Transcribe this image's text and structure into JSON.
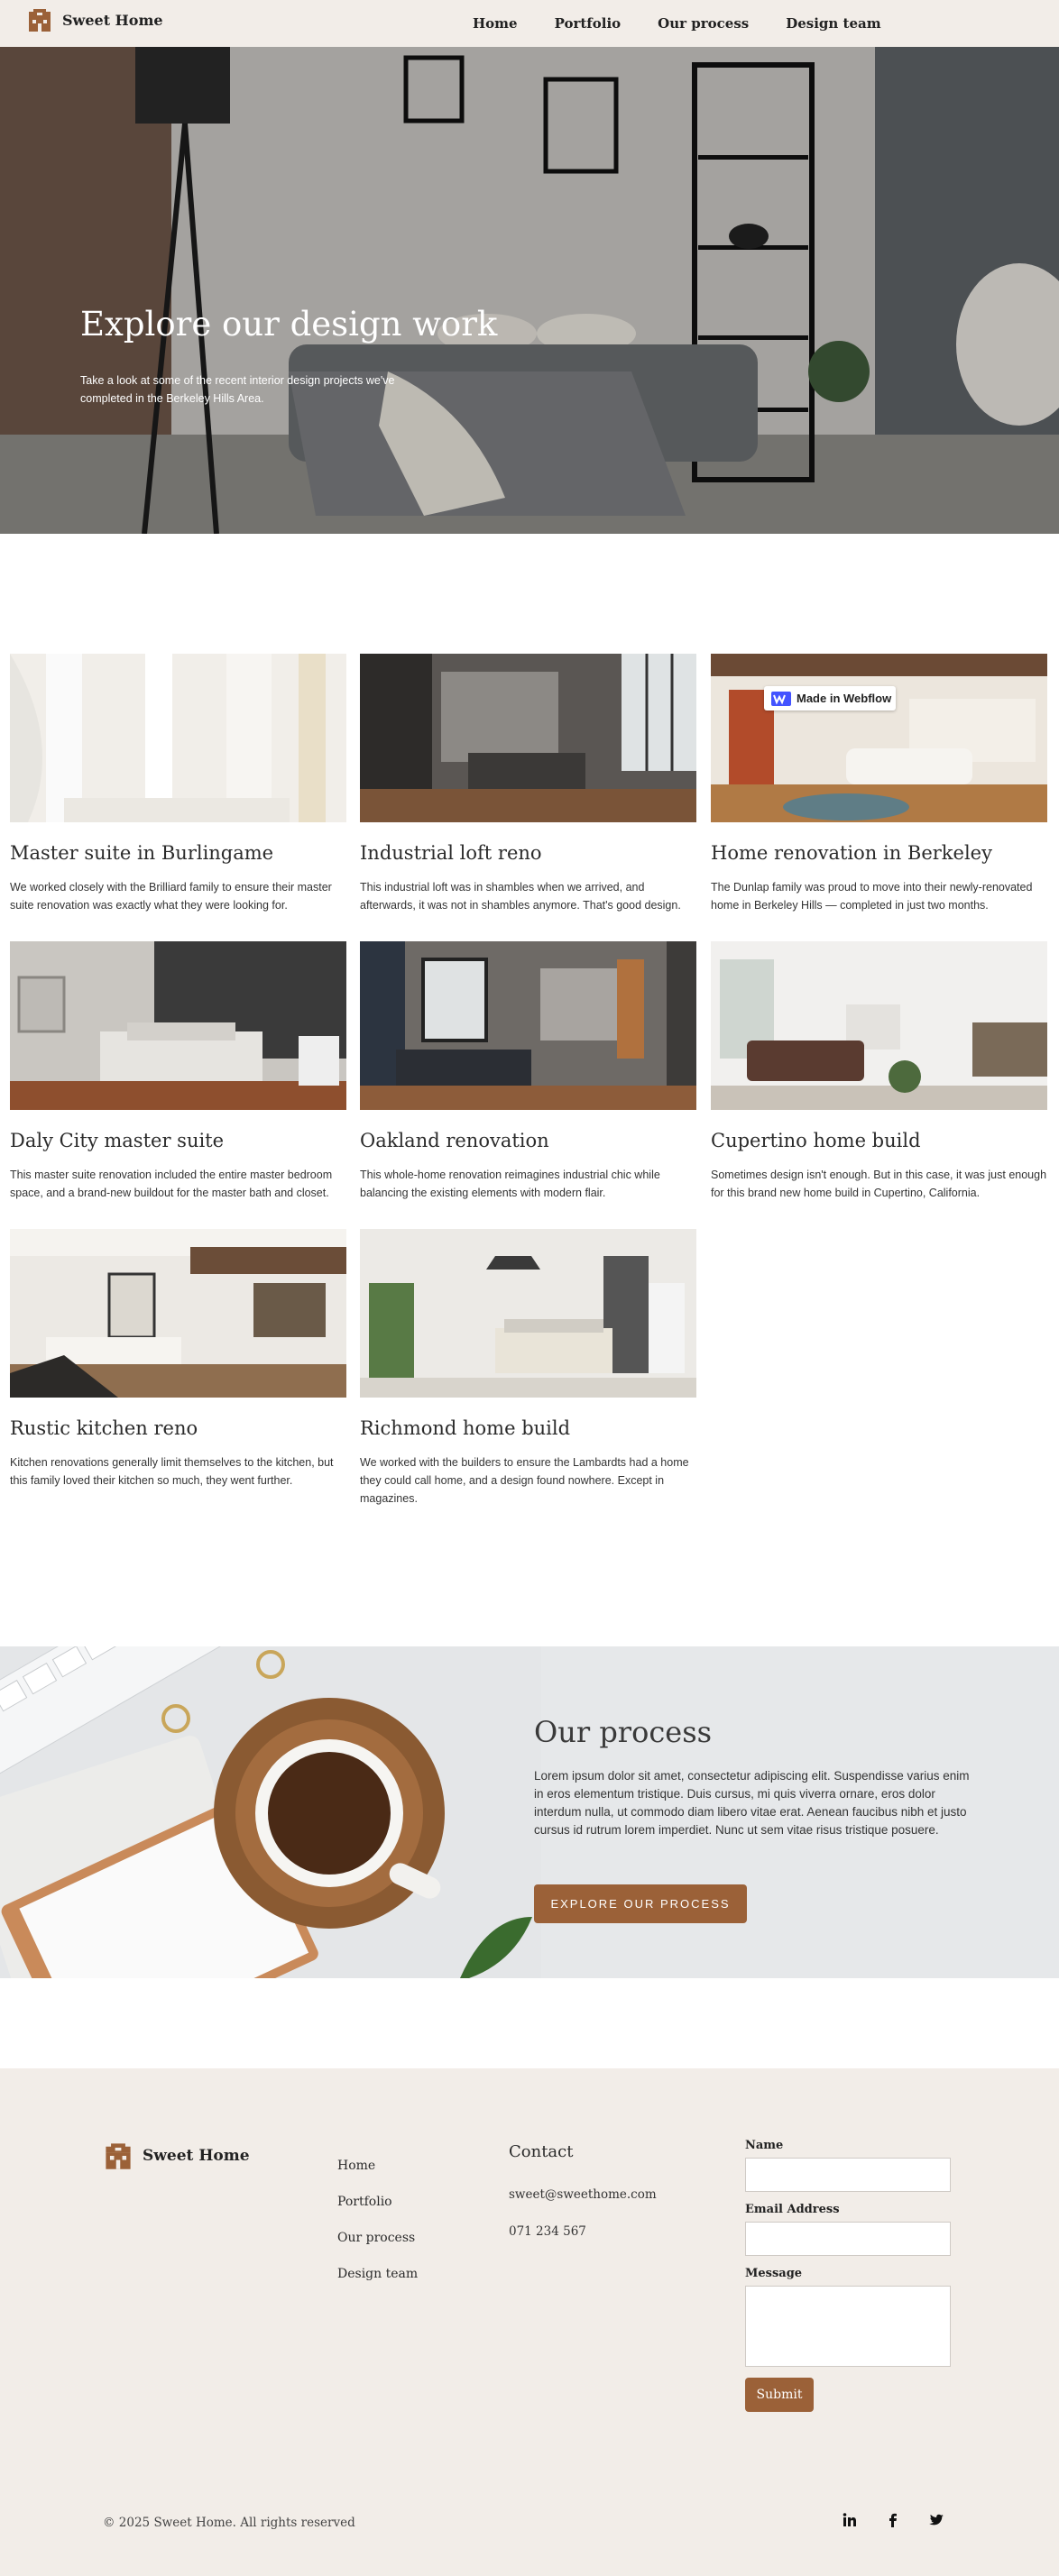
{
  "nav": {
    "brand": "Sweet Home",
    "links": [
      "Home",
      "Portfolio",
      "Our process",
      "Design team"
    ]
  },
  "hero": {
    "title": "Explore our design work",
    "subtitle": "Take a look at some of the recent interior design projects we've completed in the Berkeley Hills Area."
  },
  "badge": {
    "label": "Made in Webflow"
  },
  "projects": [
    {
      "title": "Master suite in Burlingame",
      "description": "We worked closely with the Brilliard family to ensure their master suite renovation was exactly what they were looking for."
    },
    {
      "title": "Industrial loft reno",
      "description": "This industrial loft was in shambles when we arrived, and afterwards, it was not in shambles anymore. That's good design."
    },
    {
      "title": "Home renovation in Berkeley",
      "description": "The Dunlap family was proud to move into their newly-renovated home in Berkeley Hills — completed in just two months."
    },
    {
      "title": "Daly City master suite",
      "description": "This master suite renovation included the entire master bedroom space, and a brand-new buildout for the master bath and closet."
    },
    {
      "title": "Oakland renovation",
      "description": "This whole-home renovation reimagines industrial chic while balancing the existing elements with modern flair."
    },
    {
      "title": "Cupertino home build",
      "description": "Sometimes design isn't enough. But in this case, it was just enough for this brand new home build in Cupertino, California."
    },
    {
      "title": "Rustic kitchen reno",
      "description": "Kitchen renovations generally limit themselves to the kitchen, but this family loved their kitchen so much, they went further."
    },
    {
      "title": "Richmond home build",
      "description": "We worked with the builders to ensure the Lambardts had a home they could call home, and a design found nowhere. Except in magazines."
    }
  ],
  "process": {
    "title": "Our process",
    "text": "Lorem ipsum dolor sit amet, consectetur adipiscing elit. Suspendisse varius enim in eros elementum tristique. Duis cursus, mi quis viverra ornare, eros dolor interdum nulla, ut commodo diam libero vitae erat. Aenean faucibus nibh et justo cursus id rutrum lorem imperdiet. Nunc ut sem vitae risus tristique posuere.",
    "button": "EXPLORE OUR PROCESS"
  },
  "footer": {
    "brand": "Sweet Home",
    "links": [
      "Home",
      "Portfolio",
      "Our process",
      "Design team"
    ],
    "contact_title": "Contact",
    "email": "sweet@sweethome.com",
    "phone": "071 234 567",
    "form": {
      "name_label": "Name",
      "email_label": "Email Address",
      "message_label": "Message",
      "submit": "Submit"
    },
    "copyright": "© 2025  Sweet Home. All rights reserved",
    "social": [
      "linkedin-icon",
      "facebook-icon",
      "twitter-icon"
    ]
  },
  "colors": {
    "accent": "#9b6138",
    "nav_bg": "#f2ede8",
    "footer_bg": "#f2ede8",
    "process_bg": "#e6e8ea"
  }
}
